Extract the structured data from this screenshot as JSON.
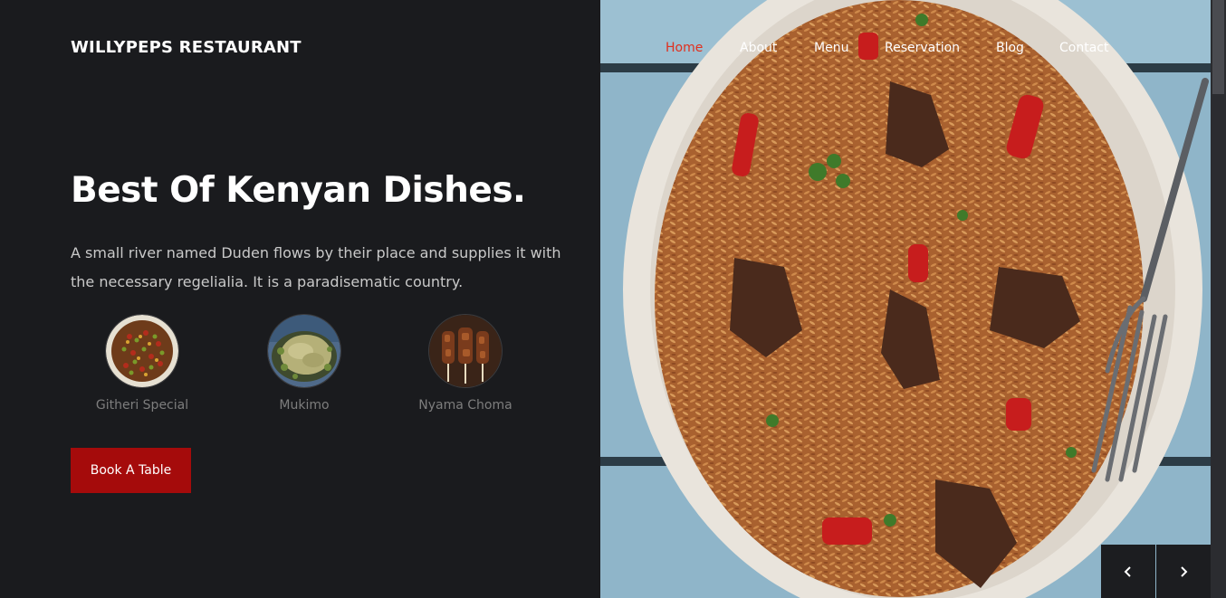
{
  "brand": "WILLYPEPS RESTAURANT",
  "nav": {
    "items": [
      "Home",
      "About",
      "Menu",
      "Reservation",
      "Blog",
      "Contact"
    ],
    "active_color": "#e0301e",
    "color": "#ffffff"
  },
  "hero": {
    "title": "Best Of Kenyan Dishes.",
    "text": "A small river named Duden flows by their place and supplies it with the necessary regelialia. It is a paradisematic country."
  },
  "dishes": [
    {
      "name": "Githeri Special"
    },
    {
      "name": "Mukimo"
    },
    {
      "name": "Nyama Choma"
    }
  ],
  "cta": {
    "label": "Book A Table"
  },
  "colors": {
    "background": "#1a1b1e",
    "accent": "#a50b0b",
    "plate": "#e9e4dc",
    "table": "#8fb5c9",
    "rice": "#b8703a"
  },
  "icons": {
    "prev": "chevron-left-icon",
    "next": "chevron-right-icon"
  }
}
